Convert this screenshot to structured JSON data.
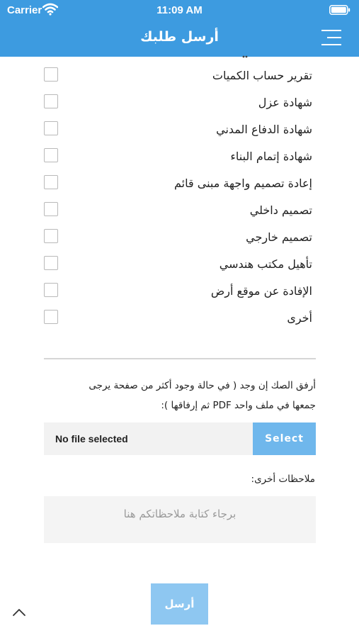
{
  "status_bar": {
    "carrier": "Carrier",
    "time": "11:09 AM"
  },
  "header": {
    "title": "أرسل طلبك",
    "background_color": "#3d9be0",
    "menu_icon": "hamburger-menu-icon"
  },
  "services": {
    "items": [
      {
        "label": "تقرير حساب الكميات",
        "checked": false
      },
      {
        "label": "شهادة عزل",
        "checked": false
      },
      {
        "label": "شهادة الدفاع المدني",
        "checked": false
      },
      {
        "label": "شهادة إتمام البناء",
        "checked": false
      },
      {
        "label": "إعادة تصميم واجهة مبنى قائم",
        "checked": false
      },
      {
        "label": "تصميم داخلي",
        "checked": false
      },
      {
        "label": "تصميم خارجي",
        "checked": false
      },
      {
        "label": "تأهيل مكتب هندسي",
        "checked": false
      },
      {
        "label": "الإفادة عن موقع أرض",
        "checked": false
      },
      {
        "label": "أخرى",
        "checked": false
      }
    ]
  },
  "attachment": {
    "instruction_line1": "أرفق الصك إن وجد ( في حالة وجود أكثر من صفحة يرجى",
    "instruction_line2": "جمعها في ملف واحد PDF ثم إرفاقها ):",
    "file_status": "No file selected",
    "select_label": "Select",
    "select_color": "#6fb7ec"
  },
  "notes": {
    "label": "ملاحظات أخرى:",
    "placeholder": "برجاء كتابة ملاحظاتكم هنا",
    "value": ""
  },
  "submit": {
    "label": "أرسل",
    "color": "#8ec7f1"
  }
}
